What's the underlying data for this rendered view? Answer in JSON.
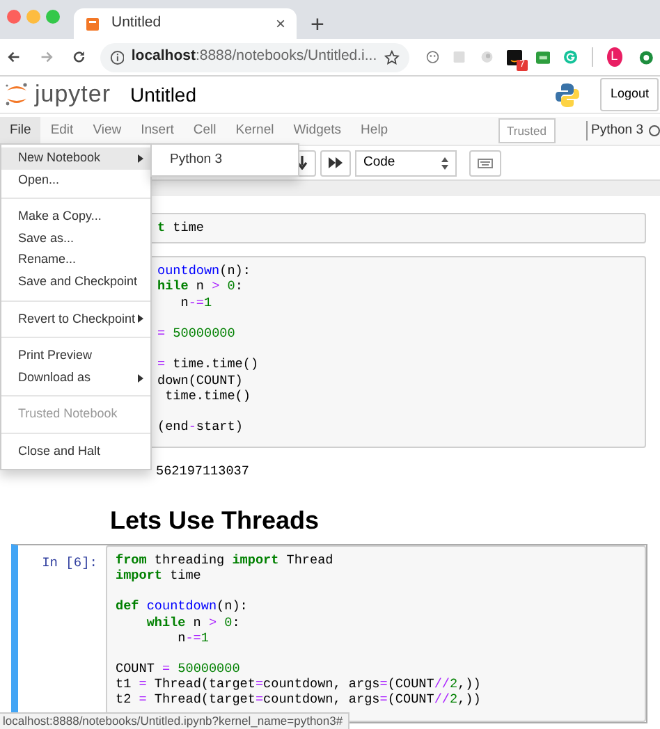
{
  "browser": {
    "tab": {
      "title": "Untitled",
      "close": "×"
    },
    "new_tab": "+",
    "url": {
      "host": "localhost",
      "rest": ":8888/notebooks/Untitled.i..."
    },
    "extension_badge": "7",
    "profile": "L"
  },
  "header": {
    "logo_text": "jupyter",
    "notebook_name": "Untitled",
    "logout": "Logout"
  },
  "menubar": {
    "items": [
      {
        "label": "File",
        "selected": true
      },
      {
        "label": "Edit",
        "selected": false
      },
      {
        "label": "View",
        "selected": false
      },
      {
        "label": "Insert",
        "selected": false
      },
      {
        "label": "Cell",
        "selected": false
      },
      {
        "label": "Kernel",
        "selected": false
      },
      {
        "label": "Widgets",
        "selected": false
      },
      {
        "label": "Help",
        "selected": false
      }
    ],
    "trusted": "Trusted",
    "kernel": "Python 3"
  },
  "toolbar": {
    "cell_type": "Code"
  },
  "file_menu": {
    "items": [
      {
        "kind": "item",
        "label": "New Notebook",
        "highlighted": true,
        "disabled": false,
        "submenu": true
      },
      {
        "kind": "item",
        "label": "Open...",
        "highlighted": false,
        "disabled": false,
        "submenu": false
      },
      {
        "kind": "divider"
      },
      {
        "kind": "item",
        "label": "Make a Copy...",
        "highlighted": false,
        "disabled": false,
        "submenu": false
      },
      {
        "kind": "item",
        "label": "Save as...",
        "highlighted": false,
        "disabled": false,
        "submenu": false
      },
      {
        "kind": "item",
        "label": "Rename...",
        "highlighted": false,
        "disabled": false,
        "submenu": false
      },
      {
        "kind": "item",
        "label": "Save and Checkpoint",
        "highlighted": false,
        "disabled": false,
        "submenu": false
      },
      {
        "kind": "divider"
      },
      {
        "kind": "item",
        "label": "Revert to Checkpoint",
        "highlighted": false,
        "disabled": false,
        "submenu": true
      },
      {
        "kind": "divider"
      },
      {
        "kind": "item",
        "label": "Print Preview",
        "highlighted": false,
        "disabled": false,
        "submenu": false
      },
      {
        "kind": "item",
        "label": "Download as",
        "highlighted": false,
        "disabled": false,
        "submenu": true
      },
      {
        "kind": "divider"
      },
      {
        "kind": "item",
        "label": "Trusted Notebook",
        "highlighted": false,
        "disabled": true,
        "submenu": false
      },
      {
        "kind": "divider"
      },
      {
        "kind": "item",
        "label": "Close and Halt",
        "highlighted": false,
        "disabled": false,
        "submenu": false
      }
    ]
  },
  "submenu": {
    "items": [
      {
        "label": "Python 3"
      }
    ]
  },
  "cells": [
    {
      "kind": "code",
      "selected": false,
      "lines": [
        {
          "kind": "code",
          "tokens": [
            {
              "text": "t",
              "kind": "kw"
            },
            {
              "text": " time",
              "kind": "plain"
            }
          ]
        }
      ]
    },
    {
      "kind": "code",
      "selected": false,
      "lines": [
        {
          "kind": "code",
          "tokens": [
            {
              "text": "ountdown",
              "kind": "def"
            },
            {
              "text": "(n):",
              "kind": "plain"
            }
          ]
        },
        {
          "kind": "code",
          "tokens": [
            {
              "text": "hile",
              "kind": "kw"
            },
            {
              "text": " n ",
              "kind": "plain"
            },
            {
              "text": ">",
              "kind": "op"
            },
            {
              "text": " 0",
              "kind": "num"
            },
            {
              "text": ":",
              "kind": "plain"
            }
          ]
        },
        {
          "kind": "code",
          "tokens": [
            {
              "text": "   n",
              "kind": "plain"
            },
            {
              "text": "-=",
              "kind": "op"
            },
            {
              "text": "1",
              "kind": "num"
            }
          ]
        },
        {
          "kind": "blank"
        },
        {
          "kind": "code",
          "tokens": [
            {
              "text": "=",
              "kind": "op"
            },
            {
              "text": " 50000000",
              "kind": "num"
            }
          ]
        },
        {
          "kind": "blank"
        },
        {
          "kind": "code",
          "tokens": [
            {
              "text": "=",
              "kind": "op"
            },
            {
              "text": " time.time()",
              "kind": "plain"
            }
          ]
        },
        {
          "kind": "code",
          "tokens": [
            {
              "text": "down(COUNT)",
              "kind": "plain"
            }
          ]
        },
        {
          "kind": "code",
          "tokens": [
            {
              "text": " time.time()",
              "kind": "plain"
            }
          ]
        },
        {
          "kind": "blank"
        },
        {
          "kind": "code",
          "tokens": [
            {
              "text": "(end",
              "kind": "plain"
            },
            {
              "text": "-",
              "kind": "op"
            },
            {
              "text": "start)",
              "kind": "plain"
            }
          ]
        }
      ]
    },
    {
      "kind": "output",
      "text": "562197113037"
    },
    {
      "kind": "heading",
      "text": "Lets Use Threads"
    },
    {
      "kind": "code",
      "selected": true,
      "prompt": "In [6]:",
      "lines": [
        {
          "kind": "code",
          "tokens": [
            {
              "text": "from",
              "kind": "kw"
            },
            {
              "text": " threading ",
              "kind": "plain"
            },
            {
              "text": "import",
              "kind": "kw"
            },
            {
              "text": " Thread",
              "kind": "plain"
            }
          ]
        },
        {
          "kind": "code",
          "tokens": [
            {
              "text": "import",
              "kind": "kw"
            },
            {
              "text": " time",
              "kind": "plain"
            }
          ]
        },
        {
          "kind": "blank"
        },
        {
          "kind": "code",
          "tokens": [
            {
              "text": "def",
              "kind": "kw"
            },
            {
              "text": " countdown",
              "kind": "def"
            },
            {
              "text": "(n):",
              "kind": "plain"
            }
          ]
        },
        {
          "kind": "code",
          "tokens": [
            {
              "text": "    while",
              "kind": "kw"
            },
            {
              "text": " n ",
              "kind": "plain"
            },
            {
              "text": ">",
              "kind": "op"
            },
            {
              "text": " 0",
              "kind": "num"
            },
            {
              "text": ":",
              "kind": "plain"
            }
          ]
        },
        {
          "kind": "code",
          "tokens": [
            {
              "text": "        n",
              "kind": "plain"
            },
            {
              "text": "-=",
              "kind": "op"
            },
            {
              "text": "1",
              "kind": "num"
            }
          ]
        },
        {
          "kind": "blank"
        },
        {
          "kind": "code",
          "tokens": [
            {
              "text": "COUNT ",
              "kind": "plain"
            },
            {
              "text": "=",
              "kind": "op"
            },
            {
              "text": " 50000000",
              "kind": "num"
            }
          ]
        },
        {
          "kind": "code",
          "tokens": [
            {
              "text": "t1 ",
              "kind": "plain"
            },
            {
              "text": "=",
              "kind": "op"
            },
            {
              "text": " Thread(target",
              "kind": "plain"
            },
            {
              "text": "=",
              "kind": "op"
            },
            {
              "text": "countdown, args",
              "kind": "plain"
            },
            {
              "text": "=",
              "kind": "op"
            },
            {
              "text": "(COUNT",
              "kind": "plain"
            },
            {
              "text": "//",
              "kind": "op"
            },
            {
              "text": "2",
              "kind": "num"
            },
            {
              "text": ",))",
              "kind": "plain"
            }
          ]
        },
        {
          "kind": "code",
          "tokens": [
            {
              "text": "t2 ",
              "kind": "plain"
            },
            {
              "text": "=",
              "kind": "op"
            },
            {
              "text": " Thread(target",
              "kind": "plain"
            },
            {
              "text": "=",
              "kind": "op"
            },
            {
              "text": "countdown, args",
              "kind": "plain"
            },
            {
              "text": "=",
              "kind": "op"
            },
            {
              "text": "(COUNT",
              "kind": "plain"
            },
            {
              "text": "//",
              "kind": "op"
            },
            {
              "text": "2",
              "kind": "num"
            },
            {
              "text": ",))",
              "kind": "plain"
            }
          ]
        }
      ]
    }
  ],
  "status_url": "localhost:8888/notebooks/Untitled.ipynb?kernel_name=python3#"
}
